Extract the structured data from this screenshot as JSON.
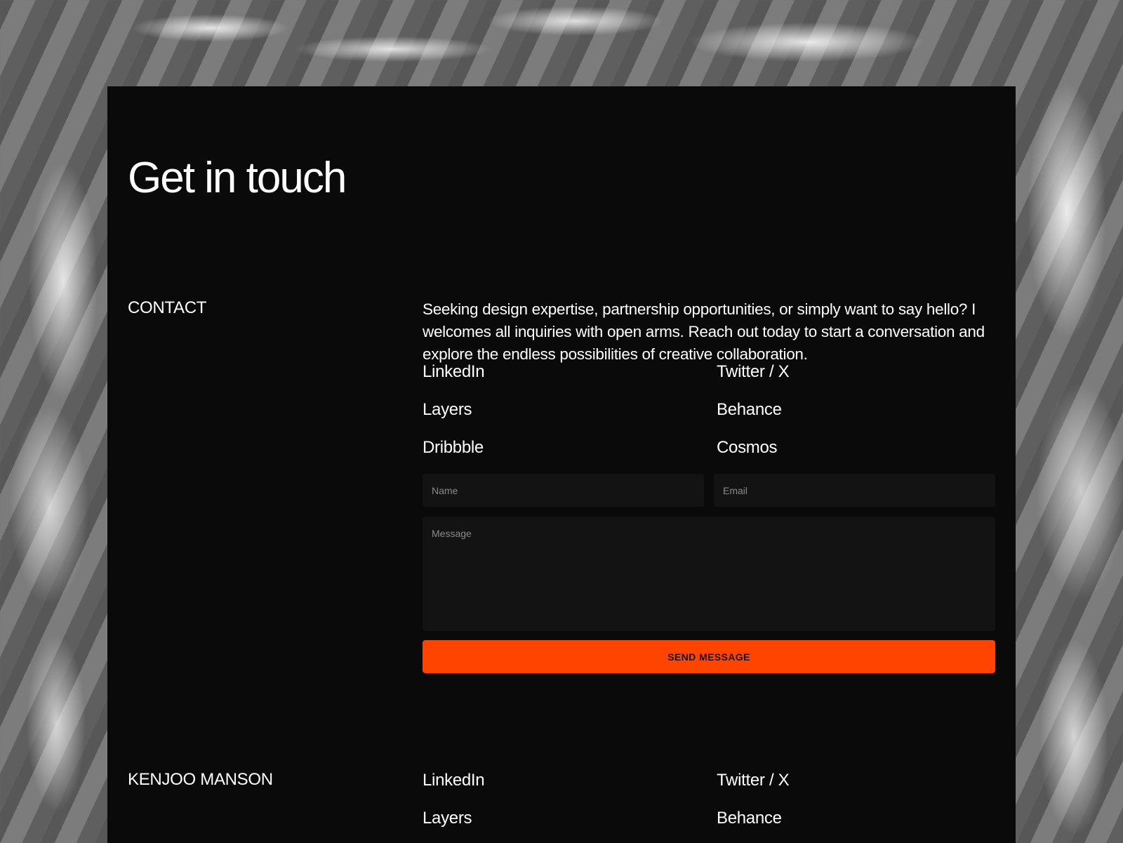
{
  "page": {
    "title": "Get in touch"
  },
  "contact": {
    "label": "CONTACT",
    "intro": "Seeking design expertise, partnership opportunities, or simply want to say hello? I welcomes all inquiries with open arms. Reach out today to start a conversation and explore the endless possibilities of creative collaboration.",
    "links": [
      "LinkedIn",
      "Twitter / X",
      "Layers",
      "Behance",
      "Dribbble",
      "Cosmos"
    ]
  },
  "form": {
    "name_placeholder": "Name",
    "email_placeholder": "Email",
    "message_placeholder": "Message",
    "send_label": "SEND MESSAGE"
  },
  "footer": {
    "label": "KENJOO MANSON",
    "links": [
      "LinkedIn",
      "Twitter / X",
      "Layers",
      "Behance"
    ]
  },
  "colors": {
    "panel_bg": "#0a0a0a",
    "accent": "#ff4400",
    "input_bg": "#131313"
  }
}
